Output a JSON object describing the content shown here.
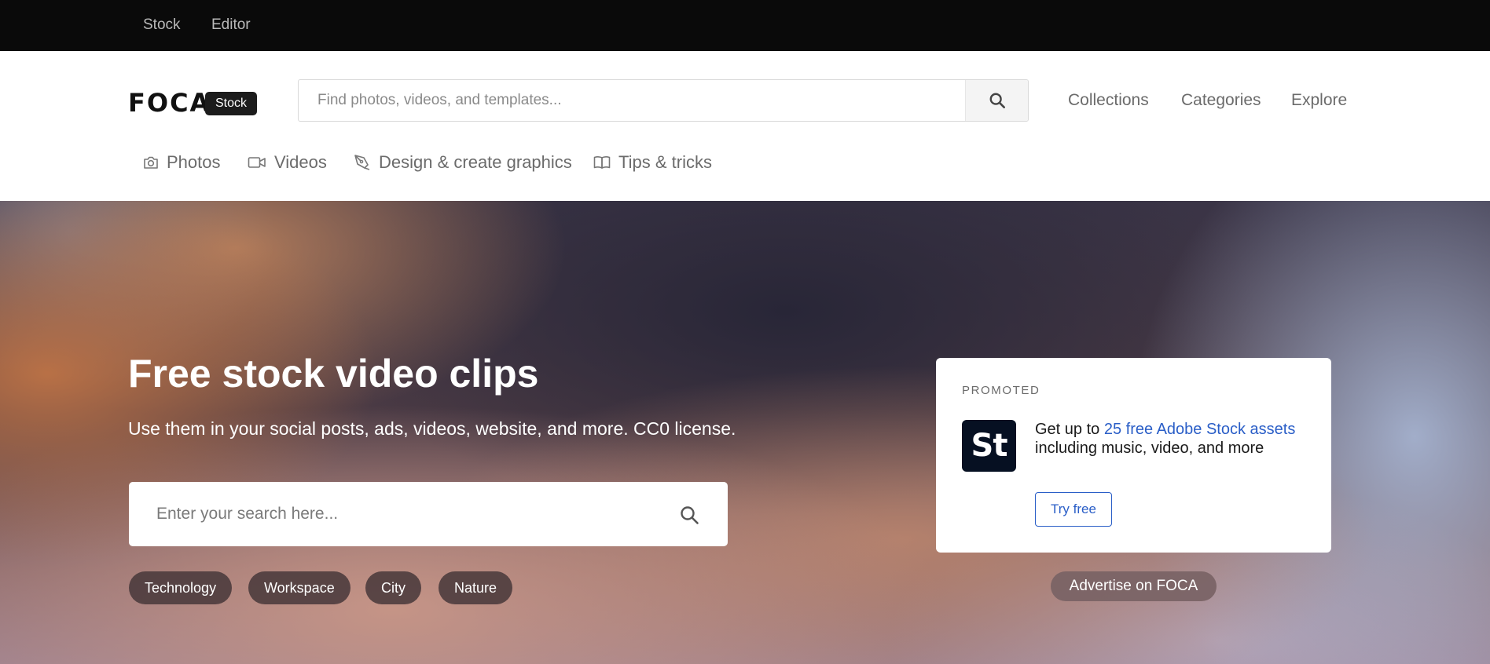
{
  "topbar": {
    "links": [
      "Stock",
      "Editor"
    ]
  },
  "header": {
    "logo": "FOCA",
    "logo_badge": "Stock",
    "search_placeholder": "Find photos, videos, and templates...",
    "nav": [
      "Collections",
      "Categories",
      "Explore"
    ],
    "subnav": [
      {
        "label": "Photos",
        "icon": "camera-icon"
      },
      {
        "label": "Videos",
        "icon": "video-camera-icon"
      },
      {
        "label": "Design & create graphics",
        "icon": "pen-tool-icon"
      },
      {
        "label": "Tips & tricks",
        "icon": "open-book-icon"
      }
    ]
  },
  "hero": {
    "title": "Free stock video clips",
    "subtitle": "Use them in your social posts, ads, videos, website, and more. CC0 license.",
    "search_placeholder": "Enter your search here...",
    "tags": [
      "Technology",
      "Workspace",
      "City",
      "Nature"
    ]
  },
  "promo": {
    "label": "PROMOTED",
    "logo_text": "St",
    "text_before": "Get up to ",
    "text_highlight": "25 free Adobe Stock assets",
    "text_after": " including music, video, and more",
    "button": "Try free",
    "advertise": "Advertise on FOCA"
  },
  "colors": {
    "topbar_bg": "#0a0a0a",
    "link_blue": "#2a5ec7",
    "promo_logo_bg": "#061022"
  }
}
